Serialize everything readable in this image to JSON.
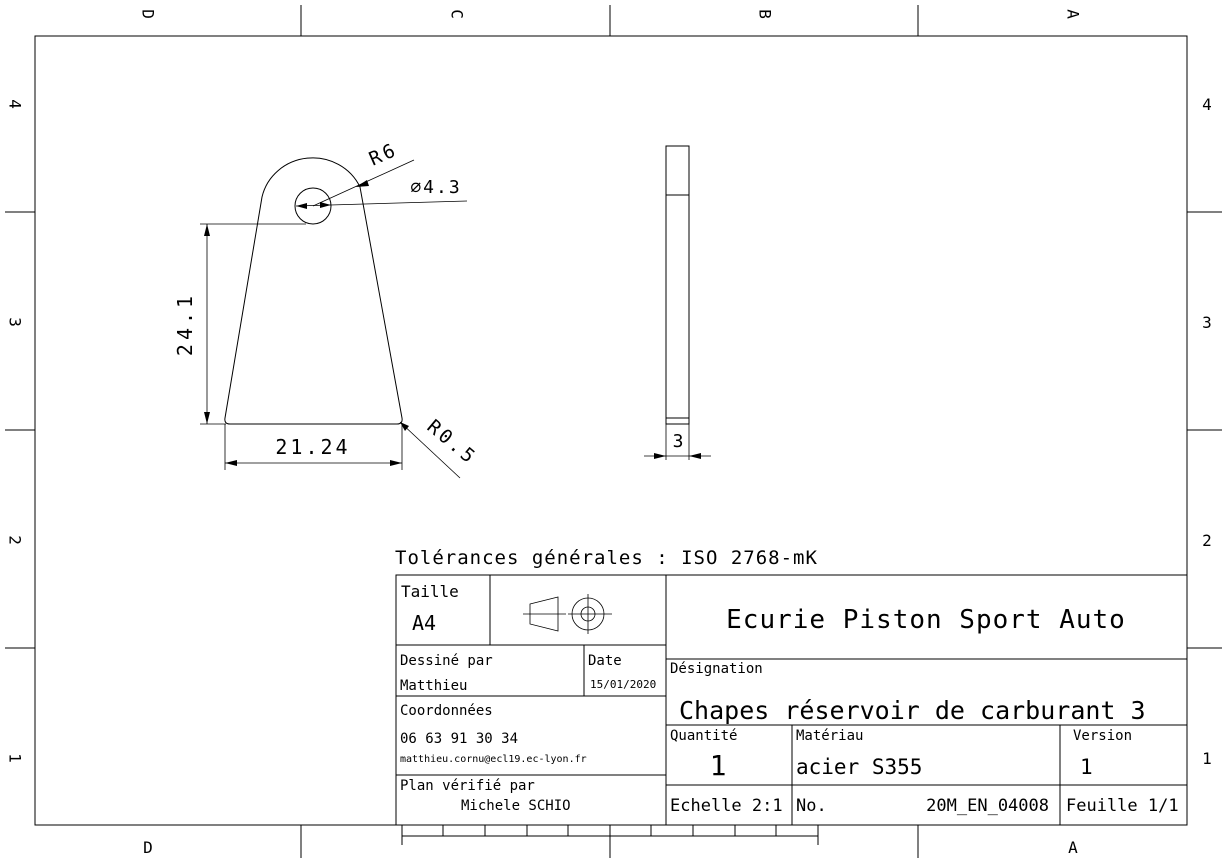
{
  "frame": {
    "columns": [
      "D",
      "C",
      "B",
      "A"
    ],
    "rows": [
      "4",
      "3",
      "2",
      "1"
    ]
  },
  "drawing": {
    "dim_radius_top": "R6",
    "dim_hole_diameter": "∅4.3",
    "dim_height": "24.1",
    "dim_base_width": "21.24",
    "dim_corner_radius": "R0.5",
    "dim_thickness": "3"
  },
  "tolerances": "Tolérances générales : ISO 2768-mK",
  "title_block": {
    "size_label": "Taille",
    "size_value": "A4",
    "company": "Ecurie Piston Sport Auto",
    "drawn_by_label": "Dessiné par",
    "drawn_by_value": "Matthieu",
    "date_label": "Date",
    "date_value": "15/01/2020",
    "designation_label": "Désignation",
    "designation_value": "Chapes réservoir de carburant 3",
    "contact_label": "Coordonnées",
    "phone": "06 63 91 30 34",
    "email": "matthieu.cornu@ecl19.ec-lyon.fr",
    "quantity_label": "Quantité",
    "quantity_value": "1",
    "material_label": "Matériau",
    "material_value": "acier S355",
    "version_label": "Version",
    "version_value": "1",
    "checked_by_label": "Plan vérifié par",
    "checked_by_value": "Michele SCHIO",
    "scale": "Echelle 2:1",
    "number_label": "No.",
    "number_value": "20M_EN_04008",
    "sheet": "Feuille 1/1"
  }
}
